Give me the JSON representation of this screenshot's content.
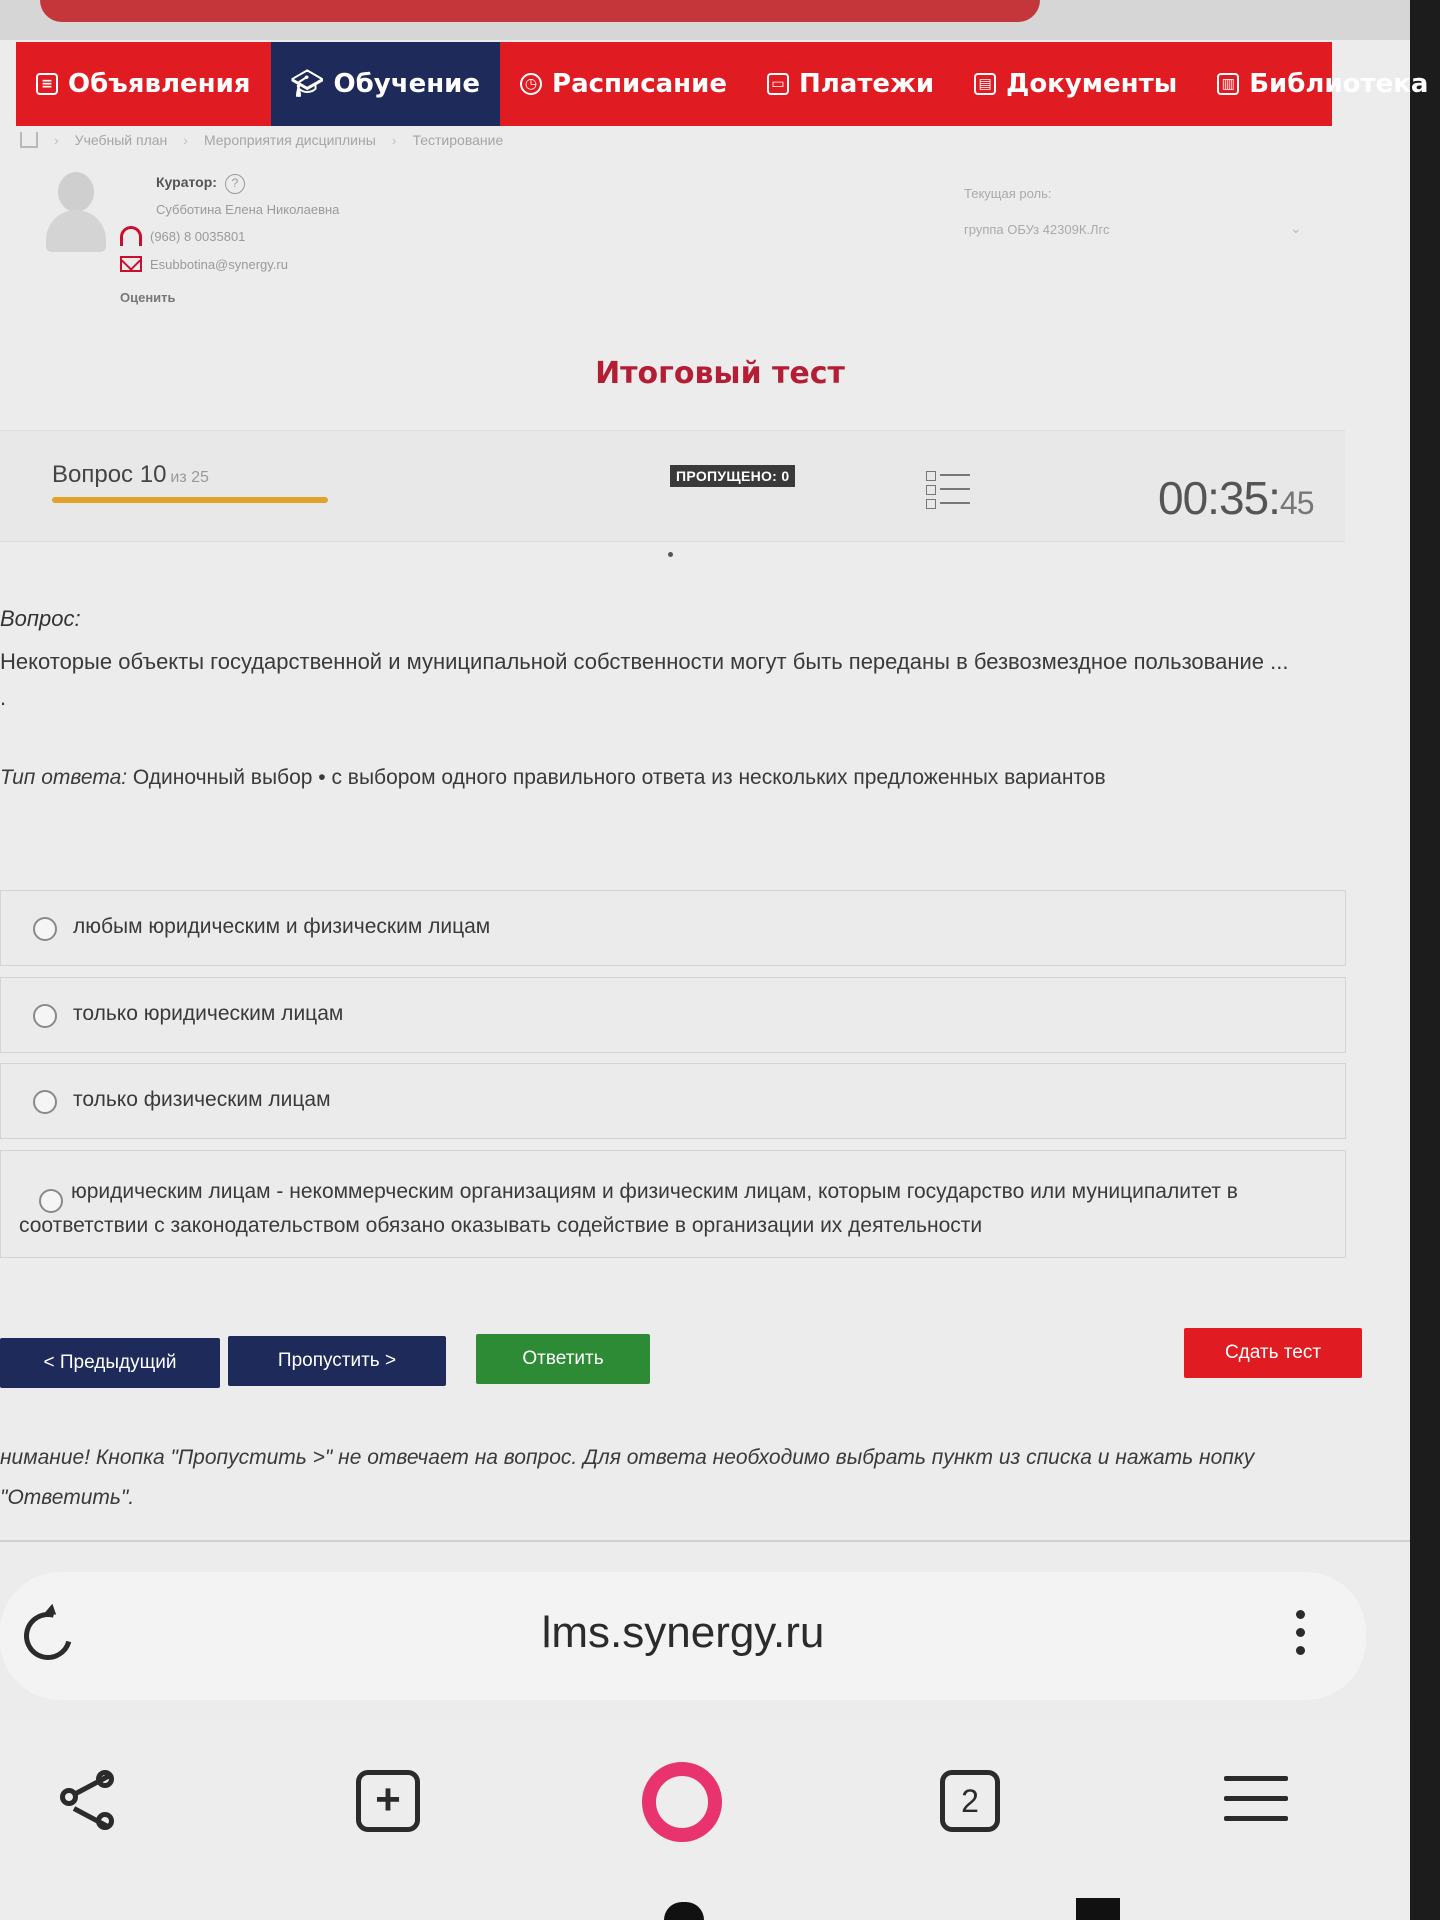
{
  "nav": {
    "items": [
      {
        "label": "Объявления",
        "icon": "announcement-icon",
        "active": false
      },
      {
        "label": "Обучение",
        "icon": "graduation-cap-icon",
        "active": true
      },
      {
        "label": "Расписание",
        "icon": "clock-icon",
        "active": false
      },
      {
        "label": "Платежи",
        "icon": "wallet-icon",
        "active": false
      },
      {
        "label": "Документы",
        "icon": "document-icon",
        "active": false
      },
      {
        "label": "Библиотека",
        "icon": "book-icon",
        "active": false
      }
    ]
  },
  "breadcrumb": [
    "Учебный план",
    "Мероприятия дисциплины",
    "Тестирование"
  ],
  "curator": {
    "label": "Куратор:",
    "name": "Субботина Елена Николаевна",
    "phone": "(968) 8 0035801",
    "email": "Esubbotina@synergy.ru",
    "rate": "Оценить"
  },
  "role": {
    "label": "Текущая роль:",
    "value": "группа ОБУз 42309К.Лгс"
  },
  "test": {
    "title": "Итоговый тест",
    "question_label": "Вопрос 10",
    "question_of": "из 25",
    "progress": 0.4,
    "skipped": "ПРОПУЩЕНО: 0",
    "timer_main": "00:35:",
    "timer_sec": "45"
  },
  "question": {
    "label": "Вопрос:",
    "text": "Некоторые объекты государственной и муниципальной собственности могут быть переданы в безвозмездное пользование ... .",
    "type_label": "Тип ответа:",
    "type_value": " Одиночный выбор • с выбором одного правильного ответа из нескольких предложенных вариантов"
  },
  "options": [
    "любым юридическим и физическим лицам",
    "только юридическим лицам",
    "только физическим лицам",
    "юридическим лицам - некоммерческим организациям и физическим лицам, которым государство или муниципалитет в соответствии с законодательством обязано оказывать содействие в организации их деятельности"
  ],
  "buttons": {
    "prev": "< Предыдущий",
    "skip": "Пропустить >",
    "answer": "Ответить",
    "submit": "Сдать тест"
  },
  "notice": "нимание! Кнопка \"Пропустить >\" не отвечает на вопрос. Для ответа необходимо выбрать пункт из списка и нажать нопку \"Ответить\".",
  "browser": {
    "url": "lms.synergy.ru",
    "tab_count": "2"
  },
  "colors": {
    "nav_red": "#e11b22",
    "nav_active": "#1d2a5a",
    "title_red": "#b41e34",
    "progress": "#e0a32a",
    "answer_green": "#2e8b35",
    "alice_pink": "#e8336e"
  }
}
